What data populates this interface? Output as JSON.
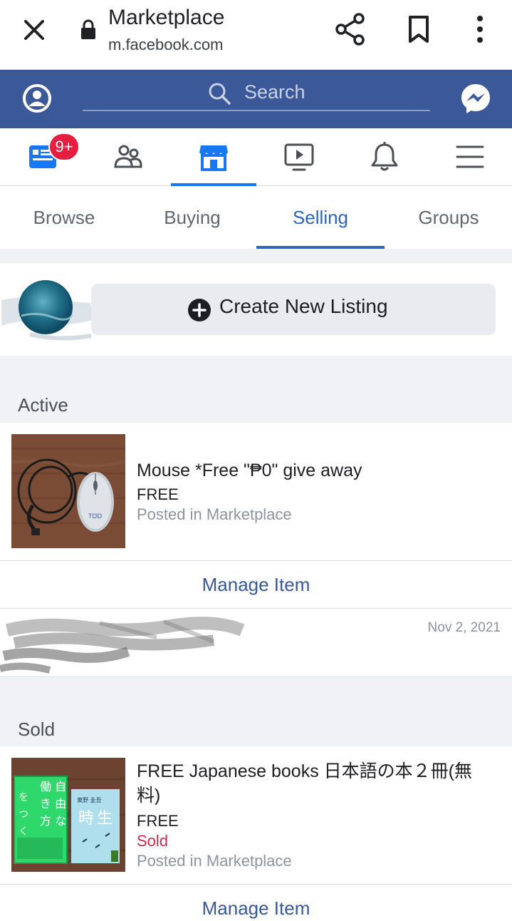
{
  "browser": {
    "title": "Marketplace",
    "url": "m.facebook.com"
  },
  "fb_header": {
    "search_placeholder": "Search"
  },
  "nav": {
    "notification_badge": "9+",
    "items": [
      "news-feed",
      "friends",
      "marketplace",
      "watch",
      "notifications",
      "menu"
    ],
    "active": "marketplace"
  },
  "tabs": {
    "items": [
      "Browse",
      "Buying",
      "Selling",
      "Groups"
    ],
    "active": "Selling"
  },
  "create": {
    "label": "Create New Listing"
  },
  "sections": {
    "active_title": "Active",
    "sold_title": "Sold"
  },
  "active_listing": {
    "name": "Mouse *Free \"₱0\" give away",
    "price": "FREE",
    "posted": "Posted in Marketplace",
    "manage": "Manage Item"
  },
  "redacted_row": {
    "date": "Nov 2, 2021"
  },
  "sold_listing": {
    "name": "FREE Japanese books 日本語の本２冊(無料)",
    "price": "FREE",
    "status": "Sold",
    "posted": "Posted in Marketplace",
    "manage": "Manage Item"
  },
  "colors": {
    "fb_blue": "#3b5998",
    "active_tab": "#2d64bc",
    "badge_red": "#e41e3f",
    "sold_red": "#d0294b"
  }
}
